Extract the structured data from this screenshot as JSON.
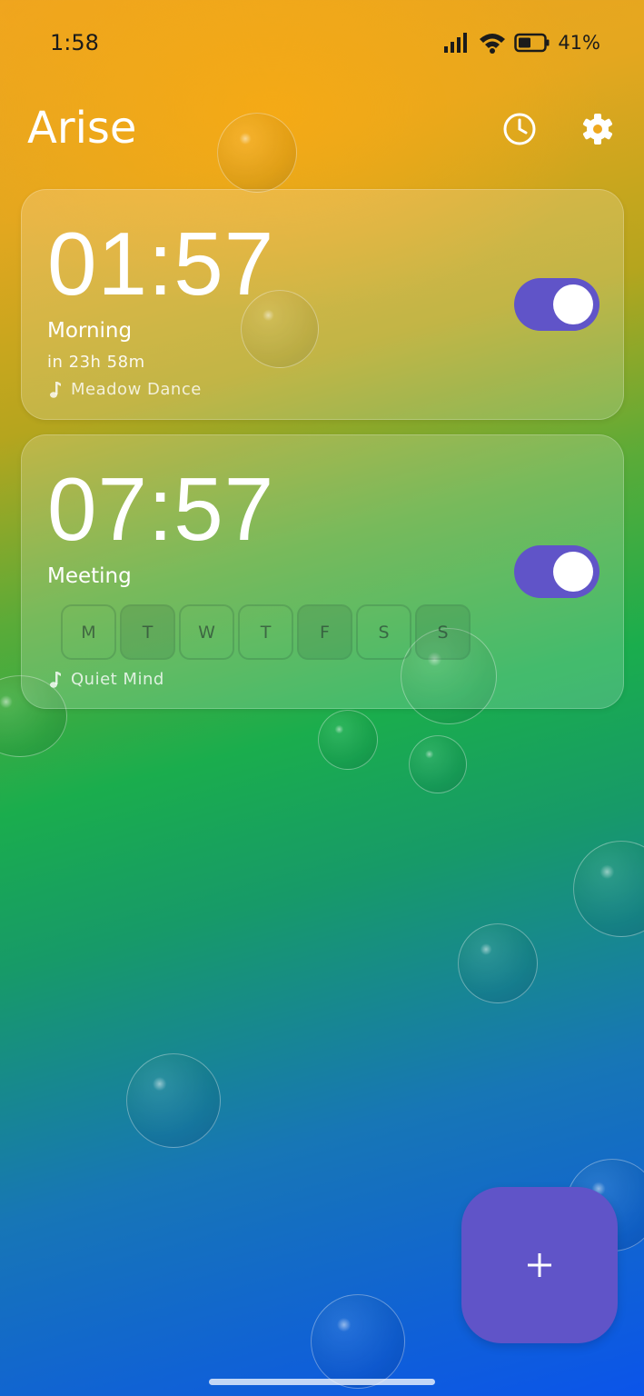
{
  "status": {
    "time": "1:58",
    "battery": "41%",
    "icons": [
      "signal-icon",
      "wifi-icon",
      "battery-icon"
    ]
  },
  "header": {
    "title": "Arise",
    "icons": [
      "history-clock-icon",
      "gear-icon"
    ]
  },
  "alarms": [
    {
      "time": "01:57",
      "label": "Morning",
      "countdown": "in 23h 58m",
      "sound": "Meadow Dance",
      "enabled": true
    },
    {
      "time": "07:57",
      "label": "Meeting",
      "sound": "Quiet Mind",
      "enabled": true,
      "days": [
        {
          "letter": "M",
          "active": false
        },
        {
          "letter": "T",
          "active": true
        },
        {
          "letter": "W",
          "active": false
        },
        {
          "letter": "T",
          "active": false
        },
        {
          "letter": "F",
          "active": true
        },
        {
          "letter": "S",
          "active": false
        },
        {
          "letter": "S",
          "active": true
        }
      ]
    }
  ],
  "fab": {
    "label": "+",
    "icon": "plus-icon"
  },
  "colors": {
    "accent": "#6054c8",
    "background_top": "#f0a51e",
    "background_bottom": "#0b54ea"
  }
}
